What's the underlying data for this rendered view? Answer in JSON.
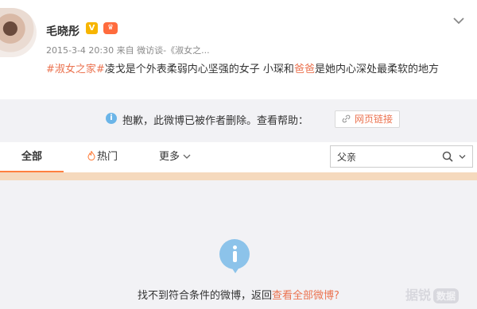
{
  "post": {
    "author": "毛晓彤",
    "vbadge": "V",
    "meta": "2015-3-4 20:30 来自 微访谈-《淑女之...",
    "content": {
      "tag": "#淑女之家#",
      "text1": "凌戈是个外表柔弱内心坚强的女子 小琛和",
      "highlight": "爸爸",
      "text2": "是她内心深处最柔软的地方"
    }
  },
  "notice": {
    "text": "抱歉，此微博已被作者删除。查看帮助：",
    "link_label": "网页链接"
  },
  "tabs": {
    "all": "全部",
    "hot": "热门",
    "more": "更多"
  },
  "search": {
    "value": "父亲"
  },
  "empty": {
    "text": "找不到符合条件的微博，返回",
    "link": "查看全部微博?"
  },
  "watermark": {
    "text": "据锐",
    "box": "数据"
  },
  "colors": {
    "accent": "#eb7350",
    "tab_underline": "#ff8140",
    "info_blue": "#8cc3ea"
  }
}
